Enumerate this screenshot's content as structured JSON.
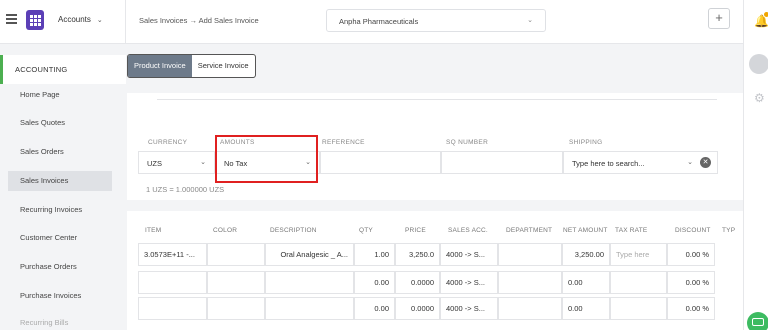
{
  "header": {
    "module": "Accounts",
    "breadcrumb": "Sales Invoices → Add Sales Invoice",
    "company": "Anpha Pharmaceuticals",
    "add_label": "+"
  },
  "sidebar": {
    "section": "ACCOUNTING",
    "items": [
      {
        "label": "Home Page"
      },
      {
        "label": "Sales Quotes"
      },
      {
        "label": "Sales Orders"
      },
      {
        "label": "Sales Invoices",
        "active": true
      },
      {
        "label": "Recurring Invoices"
      },
      {
        "label": "Customer Center"
      },
      {
        "label": "Purchase Orders"
      },
      {
        "label": "Purchase Invoices"
      },
      {
        "label": "Recurring Bills"
      }
    ]
  },
  "tabs": [
    "Product Invoice",
    "Service Invoice"
  ],
  "form": {
    "labels": {
      "currency": "CURRENCY",
      "amounts": "AMOUNTS",
      "reference": "REFERENCE",
      "sq_number": "SQ NUMBER",
      "shipping": "SHIPPING"
    },
    "currency_value": "UZS",
    "amounts_value": "No Tax",
    "reference_value": "",
    "sq_number_value": "",
    "shipping_placeholder": "Type here to search...",
    "rate_text": "1 UZS = 1.000000 UZS"
  },
  "table": {
    "headers": [
      "ITEM",
      "COLOR",
      "DESCRIPTION",
      "QTY",
      "PRICE",
      "SALES ACC.",
      "DEPARTMENT",
      "NET AMOUNT",
      "TAX RATE",
      "DISCOUNT",
      "TYP"
    ],
    "rows": [
      {
        "item": "3.0573E+11 -...",
        "color": "",
        "description": "Oral Analgesic _ A...",
        "qty": "1.00",
        "price": "3,250.0",
        "sales_acc": "4000 -> S...",
        "department": "",
        "net_amount": "3,250.00",
        "tax_rate": "Type here",
        "discount": "0.00 %"
      },
      {
        "item": "",
        "color": "",
        "description": "",
        "qty": "0.00",
        "price": "0.0000",
        "sales_acc": "4000 -> S...",
        "department": "",
        "net_amount": "0.00",
        "tax_rate": "",
        "discount": "0.00 %"
      },
      {
        "item": "",
        "color": "",
        "description": "",
        "qty": "0.00",
        "price": "0.0000",
        "sales_acc": "4000 -> S...",
        "department": "",
        "net_amount": "0.00",
        "tax_rate": "",
        "discount": "0.00 %"
      }
    ]
  },
  "colors": {
    "brand": "#5b3fb6",
    "accent_green": "#4caf50",
    "highlight_red": "#e02020",
    "tab_active": "#6d7a8a"
  },
  "icons": [
    "hamburger-icon",
    "app-grid-icon",
    "chevron-down-icon",
    "bell-icon",
    "gear-icon",
    "chat-icon",
    "clear-icon"
  ]
}
